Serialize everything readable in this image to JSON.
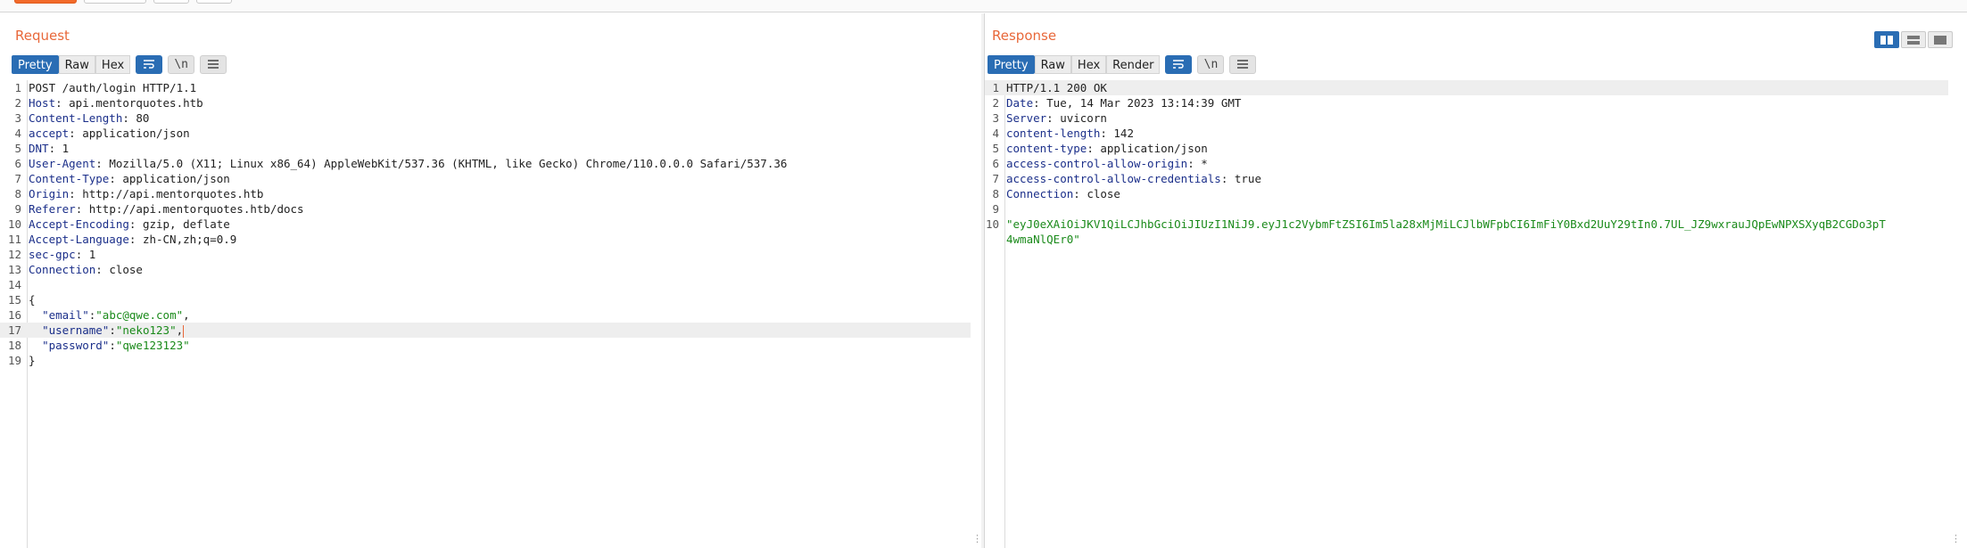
{
  "request": {
    "title": "Request",
    "tabs": [
      "Pretty",
      "Raw",
      "Hex"
    ],
    "icons": [
      "wrap-icon",
      "newline-icon",
      "menu-icon"
    ],
    "newline_label": "\\n",
    "lines": [
      {
        "n": "1",
        "segments": [
          {
            "t": "POST /auth/login HTTP/1.1",
            "c": "val"
          }
        ]
      },
      {
        "n": "2",
        "segments": [
          {
            "t": "Host",
            "c": "key"
          },
          {
            "t": ": api.mentorquotes.htb",
            "c": "val"
          }
        ]
      },
      {
        "n": "3",
        "segments": [
          {
            "t": "Content-Length",
            "c": "key"
          },
          {
            "t": ": 80",
            "c": "val"
          }
        ]
      },
      {
        "n": "4",
        "segments": [
          {
            "t": "accept",
            "c": "key"
          },
          {
            "t": ": application/json",
            "c": "val"
          }
        ]
      },
      {
        "n": "5",
        "segments": [
          {
            "t": "DNT",
            "c": "key"
          },
          {
            "t": ": 1",
            "c": "val"
          }
        ]
      },
      {
        "n": "6",
        "segments": [
          {
            "t": "User-Agent",
            "c": "key"
          },
          {
            "t": ": Mozilla/5.0 (X11; Linux x86_64) AppleWebKit/537.36 (KHTML, like Gecko) Chrome/110.0.0.0 Safari/537.36",
            "c": "val"
          }
        ]
      },
      {
        "n": "7",
        "segments": [
          {
            "t": "Content-Type",
            "c": "key"
          },
          {
            "t": ": application/json",
            "c": "val"
          }
        ]
      },
      {
        "n": "8",
        "segments": [
          {
            "t": "Origin",
            "c": "key"
          },
          {
            "t": ": http://api.mentorquotes.htb",
            "c": "val"
          }
        ]
      },
      {
        "n": "9",
        "segments": [
          {
            "t": "Referer",
            "c": "key"
          },
          {
            "t": ": http://api.mentorquotes.htb/docs",
            "c": "val"
          }
        ]
      },
      {
        "n": "10",
        "segments": [
          {
            "t": "Accept-Encoding",
            "c": "key"
          },
          {
            "t": ": gzip, deflate",
            "c": "val"
          }
        ]
      },
      {
        "n": "11",
        "segments": [
          {
            "t": "Accept-Language",
            "c": "key"
          },
          {
            "t": ": zh-CN,zh;q=0.9",
            "c": "val"
          }
        ]
      },
      {
        "n": "12",
        "segments": [
          {
            "t": "sec-gpc",
            "c": "key"
          },
          {
            "t": ": 1",
            "c": "val"
          }
        ]
      },
      {
        "n": "13",
        "segments": [
          {
            "t": "Connection",
            "c": "key"
          },
          {
            "t": ": close",
            "c": "val"
          }
        ]
      },
      {
        "n": "14",
        "segments": []
      },
      {
        "n": "15",
        "segments": [
          {
            "t": "{",
            "c": "val"
          }
        ]
      },
      {
        "n": "16",
        "segments": [
          {
            "t": "  ",
            "c": "val"
          },
          {
            "t": "\"email\"",
            "c": "jkey"
          },
          {
            "t": ":",
            "c": "val"
          },
          {
            "t": "\"abc@qwe.com\"",
            "c": "str"
          },
          {
            "t": ",",
            "c": "val"
          }
        ]
      },
      {
        "n": "17",
        "segments": [
          {
            "t": "  ",
            "c": "val"
          },
          {
            "t": "\"username\"",
            "c": "jkey"
          },
          {
            "t": ":",
            "c": "val"
          },
          {
            "t": "\"neko123\"",
            "c": "str"
          },
          {
            "t": ",",
            "c": "val"
          }
        ],
        "highlight": true,
        "caret": true
      },
      {
        "n": "18",
        "segments": [
          {
            "t": "  ",
            "c": "val"
          },
          {
            "t": "\"password\"",
            "c": "jkey"
          },
          {
            "t": ":",
            "c": "val"
          },
          {
            "t": "\"qwe123123\"",
            "c": "str"
          }
        ]
      },
      {
        "n": "19",
        "segments": [
          {
            "t": "}",
            "c": "val"
          }
        ]
      }
    ]
  },
  "response": {
    "title": "Response",
    "tabs": [
      "Pretty",
      "Raw",
      "Hex",
      "Render"
    ],
    "icons": [
      "wrap-icon",
      "newline-icon",
      "menu-icon"
    ],
    "newline_label": "\\n",
    "lines": [
      {
        "n": "1",
        "segments": [
          {
            "t": "HTTP/1.1 200 OK",
            "c": "val"
          }
        ],
        "highlight": true
      },
      {
        "n": "2",
        "segments": [
          {
            "t": "Date",
            "c": "key"
          },
          {
            "t": ": Tue, 14 Mar 2023 13:14:39 GMT",
            "c": "val"
          }
        ]
      },
      {
        "n": "3",
        "segments": [
          {
            "t": "Server",
            "c": "key"
          },
          {
            "t": ": uvicorn",
            "c": "val"
          }
        ]
      },
      {
        "n": "4",
        "segments": [
          {
            "t": "content-length",
            "c": "key"
          },
          {
            "t": ": 142",
            "c": "val"
          }
        ]
      },
      {
        "n": "5",
        "segments": [
          {
            "t": "content-type",
            "c": "key"
          },
          {
            "t": ": application/json",
            "c": "val"
          }
        ]
      },
      {
        "n": "6",
        "segments": [
          {
            "t": "access-control-allow-origin",
            "c": "key"
          },
          {
            "t": ": *",
            "c": "val"
          }
        ]
      },
      {
        "n": "7",
        "segments": [
          {
            "t": "access-control-allow-credentials",
            "c": "key"
          },
          {
            "t": ": true",
            "c": "val"
          }
        ]
      },
      {
        "n": "8",
        "segments": [
          {
            "t": "Connection",
            "c": "key"
          },
          {
            "t": ": close",
            "c": "val"
          }
        ]
      },
      {
        "n": "9",
        "segments": []
      },
      {
        "n": "10",
        "segments": [
          {
            "t": "\"eyJ0eXAiOiJKV1QiLCJhbGciOiJIUzI1NiJ9.eyJ1c2VybmFtZSI6Im5la28xMjMiLCJlbWFpbCI6ImFiY0Bxd2UuY29tIn0.7UL_JZ9wxrauJQpEwNPXSXyqB2CGDo3pT",
            "c": "str"
          }
        ],
        "cont": "4wmaNlQEr0\""
      }
    ]
  },
  "layout_toggles": [
    "split-horizontal-icon",
    "split-vertical-icon",
    "single-pane-icon"
  ],
  "colors": {
    "accent": "#e8683a",
    "active_tab": "#2a6db4",
    "header_key": "#1b2f8a",
    "string": "#1a8a1a"
  }
}
